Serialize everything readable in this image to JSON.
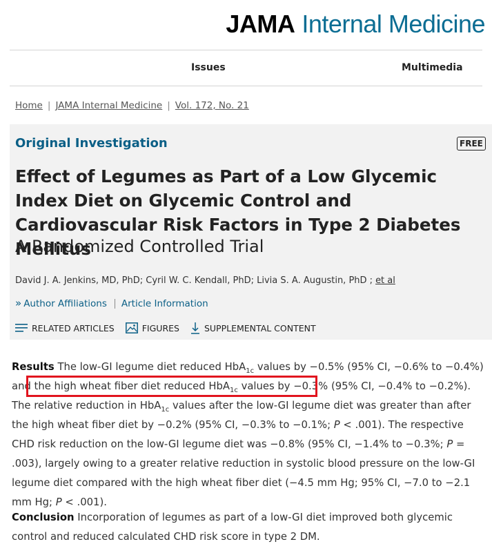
{
  "header": {
    "brand": "JAMA",
    "journal": "Internal Medicine"
  },
  "nav": {
    "issues": "Issues",
    "multimedia": "Multimedia"
  },
  "breadcrumb": {
    "home": "Home",
    "journal": "JAMA Internal Medicine",
    "volume": "Vol. 172, No. 21",
    "separator": "|"
  },
  "article": {
    "type": "Original Investigation",
    "badge": "FREE",
    "title": "Effect of Legumes as Part of a Low Glycemic Index Diet on Glycemic Control and Cardiovascular Risk Factors in Type 2 Diabetes Mellitus",
    "subtitle": "A Randomized Controlled Trial",
    "authors": "David J. A. Jenkins, MD, PhD; Cyril W. C. Kendall, PhD; Livia S. A. Augustin, PhD ;",
    "et_al": "et al",
    "author_affiliations": "Author Affiliations",
    "article_information": "Article Information"
  },
  "tools": {
    "related": "RELATED ARTICLES",
    "figures": "FIGURES",
    "supplemental": "SUPPLEMENTAL CONTENT"
  },
  "abstract": {
    "results_label": "Results",
    "results": {
      "p1": " The low-GI legume diet reduced HbA",
      "p1_sub": "1c",
      "p2": " values by −0.5% (95% CI, −0.6% to −0.4%) and the high wheat fiber diet reduced HbA",
      "p2_sub": "1c",
      "p3": " values by −0.3% (95% CI, −0.4% to −0.2%). The relative reduction in HbA",
      "p3_sub": "1c",
      "p4": " values after the low-GI legume diet was greater than after the high wheat fiber diet by −0.2% (95% CI, −0.3% to −0.1%; ",
      "p_italic_1": "P",
      "p5": " < .001). The respective CHD risk reduction on the low-GI legume diet was −0.8% (95% CI, −1.4% to −0.3%; ",
      "p_italic_2": "P",
      "p6": " = .003), largely owing to a greater relative reduction in systolic blood pressure on the low-GI legume diet compared with the high wheat fiber diet (−4.5 mm Hg; 95% CI, −7.0 to −2.1 mm Hg; ",
      "p_italic_3": "P",
      "p7": " < .001)."
    },
    "conclusion_label": "Conclusion",
    "conclusion": " Incorporation of legumes as part of a low-GI diet improved both glycemic control and reduced calculated CHD risk score in type 2 DM."
  },
  "colors": {
    "brand_blue": "#0b6d93",
    "link_blue": "#0b5f86",
    "highlight_red": "#e1141e",
    "panel_gray": "#f2f2f2"
  },
  "icons": [
    "chevron-right-icon",
    "list-icon",
    "image-icon",
    "download-arrow-icon"
  ]
}
